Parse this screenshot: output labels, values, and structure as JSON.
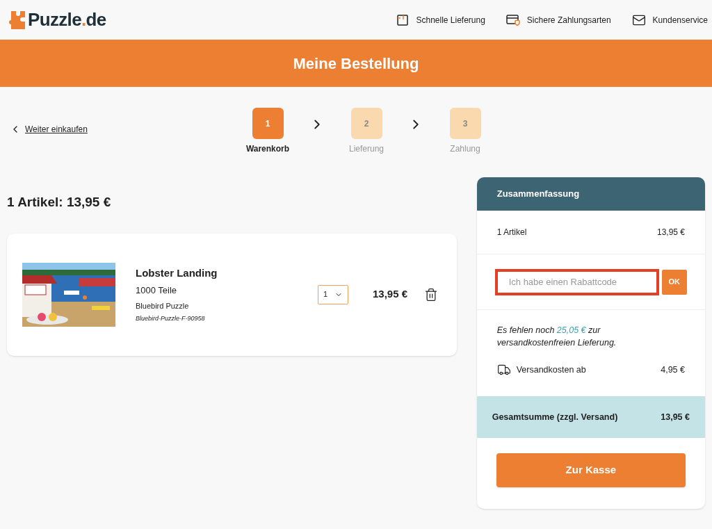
{
  "logo": {
    "name": "Puzzle",
    "dot": ".",
    "tld": "de"
  },
  "header_links": [
    {
      "kind": "delivery",
      "label": "Schnelle Lieferung"
    },
    {
      "kind": "payment",
      "label": "Sichere Zahlungsarten"
    },
    {
      "kind": "mail",
      "label": "Kundenservice"
    }
  ],
  "banner": {
    "title": "Meine Bestellung"
  },
  "back_link": "Weiter einkaufen",
  "steps": [
    {
      "number": "1",
      "label": "Warenkorb",
      "selected": true
    },
    {
      "number": "2",
      "label": "Lieferung",
      "selected": false
    },
    {
      "number": "3",
      "label": "Zahlung",
      "selected": false
    }
  ],
  "cart": {
    "heading": "1 Artikel: 13,95 €",
    "items": [
      {
        "kind": "picture",
        "title": "Lobster Landing",
        "pieces": "1000 Teile",
        "brand": "Bluebird Puzzle",
        "sku": "Bluebird-Puzzle-F-90958",
        "quantity": "1",
        "price": "13,95 €"
      }
    ]
  },
  "summary": {
    "title": "Zusammenfassung",
    "items_label": "1 Artikel",
    "items_total": "13,95 €",
    "coupon": {
      "placeholder": "Ich habe einen Rabattcode",
      "highlighted": true,
      "button": "OK"
    },
    "note": {
      "before": "Es fehlen noch ",
      "amount": "25,05 €",
      "after": " zur versandkostenfreien Lieferung."
    },
    "shipping_label": "Versandkosten ab",
    "shipping_cost": "4,95 €",
    "total_label": "Gesamtsumme (zzgl. Versand)",
    "total": "13,95 €",
    "checkout_button": "Zur Kasse"
  }
}
